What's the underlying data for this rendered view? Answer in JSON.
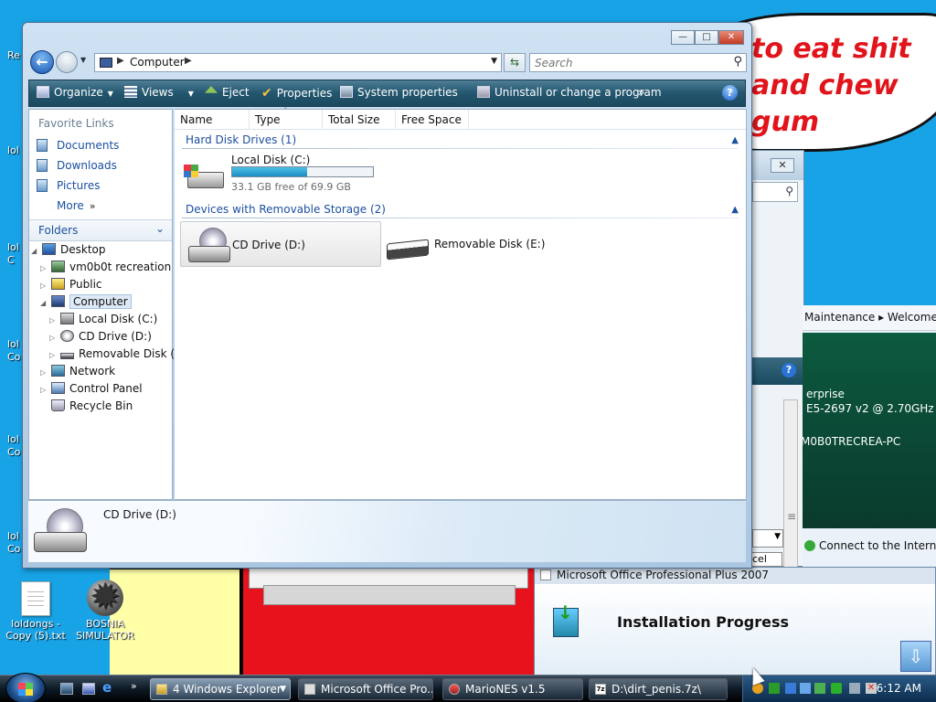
{
  "desktop": {
    "icons": [
      {
        "label": "loldongs - Copy (5).txt"
      },
      {
        "label": "BOSNIA SIMULATOR"
      }
    ],
    "edge_labels": [
      "Re",
      "lol",
      "lol C",
      "lol Co",
      "lol Co",
      "lol Co"
    ],
    "speech_bubble": "to eat shit\nand chew\ngum"
  },
  "background_windows": {
    "system": {
      "breadcrumb": "Maintenance  ▸  Welcome",
      "info_lines": [
        "erprise",
        "E5-2697 v2 @ 2.70GHz",
        "M0B0TRECREA-PC"
      ],
      "connect_label": "Connect to the Internet",
      "cancel_stub": "cel"
    },
    "office_installer": {
      "window_title": "Microsoft Office Professional Plus 2007",
      "heading": "Installation Progress"
    }
  },
  "explorer": {
    "window_buttons": {
      "minimize": "—",
      "maximize": "□",
      "close": "✕"
    },
    "address": {
      "location": "Computer"
    },
    "search": {
      "placeholder": "Search"
    },
    "toolbar": {
      "organize": "Organize",
      "views": "Views",
      "eject": "Eject",
      "properties": "Properties",
      "system_properties": "System properties",
      "uninstall": "Uninstall or change a program",
      "more": "»",
      "help": "?"
    },
    "nav": {
      "favorite_links_heading": "Favorite Links",
      "favorites": [
        "Documents",
        "Downloads",
        "Pictures",
        "More"
      ],
      "folders_heading": "Folders",
      "tree": {
        "desktop": "Desktop",
        "user": "vm0b0t recreation",
        "public": "Public",
        "computer": "Computer",
        "local_disk": "Local Disk (C:)",
        "cd_drive": "CD Drive (D:)",
        "removable": "Removable Disk (E:)",
        "network": "Network",
        "control_panel": "Control Panel",
        "recycle_bin": "Recycle Bin"
      }
    },
    "columns": [
      "Name",
      "Type",
      "Total Size",
      "Free Space"
    ],
    "groups": {
      "hard_disks": "Hard Disk Drives (1)",
      "removable": "Devices with Removable Storage (2)"
    },
    "drives": {
      "c": {
        "name": "Local Disk (C:)",
        "free_text": "33.1 GB free of 69.9 GB",
        "used_fraction": 0.53
      },
      "d": {
        "name": "CD Drive (D:)"
      },
      "e": {
        "name": "Removable Disk (E:)"
      }
    },
    "details_pane": {
      "name": "CD Drive (D:)"
    }
  },
  "taskbar": {
    "tasks": [
      {
        "label": "4 Windows Explorer"
      },
      {
        "label": "Microsoft Office Pro..."
      },
      {
        "label": "MarioNES v1.5"
      },
      {
        "label": "D:\\dirt_penis.7z\\"
      }
    ],
    "seven_zip_icon": "7z",
    "clock": "6:12 AM"
  }
}
